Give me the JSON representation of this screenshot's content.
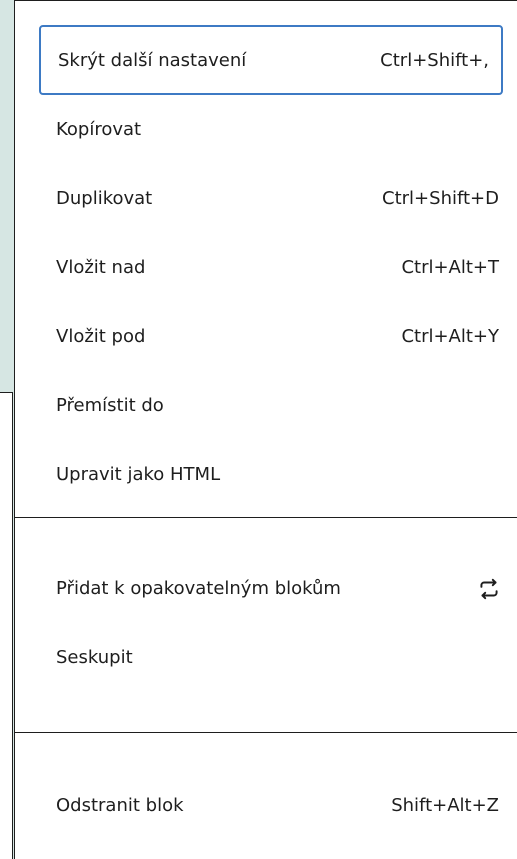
{
  "menu": {
    "items": [
      {
        "label": "Skrýt další nastavení",
        "shortcut": "Ctrl+Shift+,"
      },
      {
        "label": "Kopírovat",
        "shortcut": ""
      },
      {
        "label": "Duplikovat",
        "shortcut": "Ctrl+Shift+D"
      },
      {
        "label": "Vložit nad",
        "shortcut": "Ctrl+Alt+T"
      },
      {
        "label": "Vložit pod",
        "shortcut": "Ctrl+Alt+Y"
      },
      {
        "label": "Přemístit do",
        "shortcut": ""
      },
      {
        "label": "Upravit jako HTML",
        "shortcut": ""
      },
      {
        "label": "Přidat k opakovatelným blokům",
        "icon": "reusable-block-icon"
      },
      {
        "label": "Seskupit",
        "shortcut": ""
      },
      {
        "label": "Odstranit blok",
        "shortcut": "Shift+Alt+Z"
      }
    ]
  },
  "colors": {
    "focus_ring": "#3d7ac4",
    "background": "#d6e6e3",
    "text": "#1e1e1e"
  }
}
